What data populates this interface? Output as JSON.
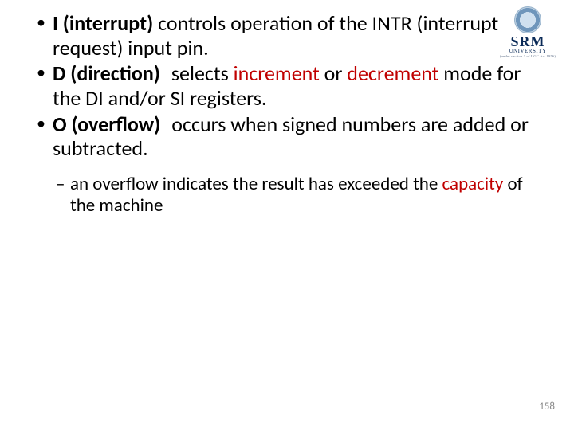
{
  "logo": {
    "word": "SRM",
    "sub": "UNIVERSITY",
    "tag": "(under section 3 of UGC Act 1956)"
  },
  "bullets": {
    "b1_bold": "I (interrupt)",
    "b1_rest_a": " controls operation of the INTR (interrupt request) input pin.",
    "b2_bold": "D (direction)",
    "b2_rest_a": "selects ",
    "b2_red1": "increment",
    "b2_rest_b": " or ",
    "b2_red2": "decrement",
    "b2_rest_c": " mode for the DI and/or SI registers.",
    "b3_bold": "O (overflow)",
    "b3_rest_a": "occurs when signed numbers are added or subtracted."
  },
  "subbullets": {
    "s1_a": "an overflow indicates the result has exceeded the ",
    "s1_red": "capacity",
    "s1_b": " of the machine"
  },
  "page_number": "158"
}
